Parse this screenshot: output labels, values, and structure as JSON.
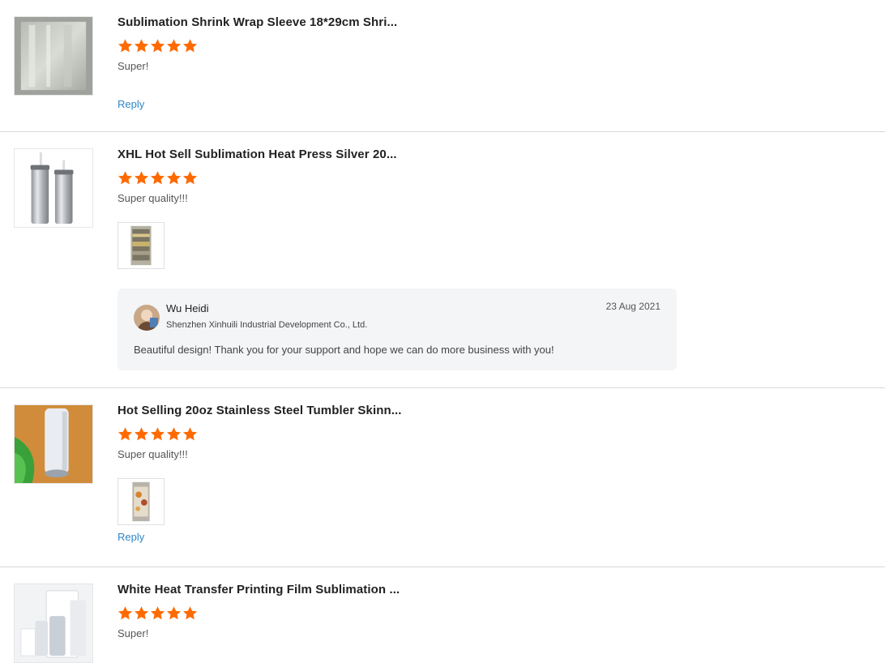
{
  "colors": {
    "star": "#ff6a00",
    "link": "#2f86c8",
    "divider": "#d9d9d9",
    "reply_bg": "#f4f5f7"
  },
  "reviews": [
    {
      "title": "Sublimation Shrink Wrap Sleeve 18*29cm Shri...",
      "rating": 5,
      "comment": "Super!",
      "has_photo": false,
      "reply_label": "Reply"
    },
    {
      "title": "XHL Hot Sell Sublimation Heat Press Silver 20...",
      "rating": 5,
      "comment": "Super quality!!!",
      "has_photo": true,
      "seller_reply": {
        "name": "Wu Heidi",
        "company": "Shenzhen Xinhuili Industrial Development Co., Ltd.",
        "date": "23 Aug 2021",
        "text": "Beautiful design! Thank you for your support and hope we can do more business with you!"
      }
    },
    {
      "title": "Hot Selling 20oz Stainless Steel Tumbler Skinn...",
      "rating": 5,
      "comment": "Super quality!!!",
      "has_photo": true,
      "reply_label": "Reply"
    },
    {
      "title": "White Heat Transfer Printing Film Sublimation ...",
      "rating": 5,
      "comment": "Super!",
      "has_photo": false
    }
  ]
}
